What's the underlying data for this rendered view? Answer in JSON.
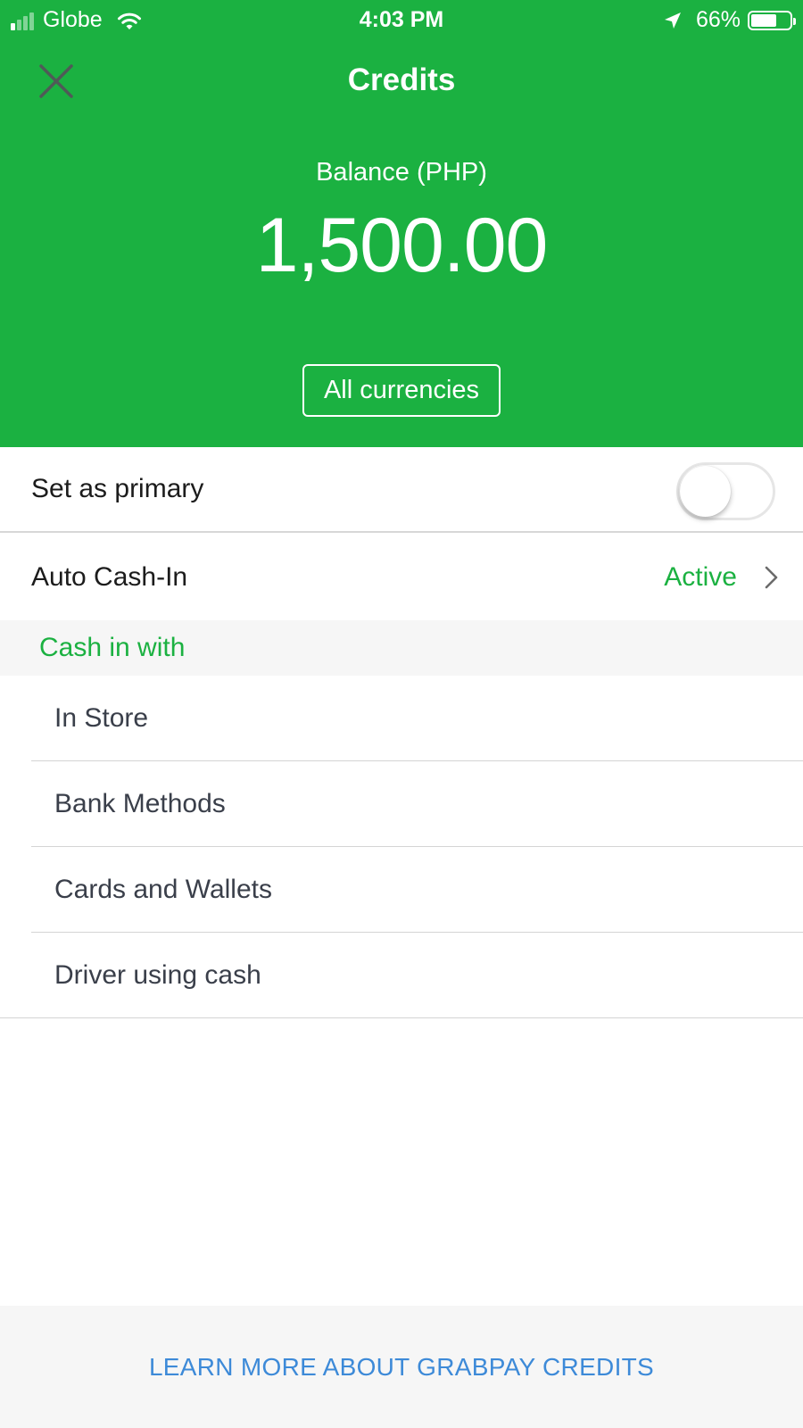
{
  "status_bar": {
    "carrier": "Globe",
    "time": "4:03 PM",
    "battery_percent": "66%",
    "battery_level": 0.66,
    "signal_bars_active": 1,
    "signal_bars_total": 4,
    "icons": [
      "signal-icon",
      "wifi-icon",
      "location-arrow-icon",
      "battery-icon"
    ]
  },
  "header": {
    "title": "Credits",
    "close_icon": "close-icon",
    "balance_label": "Balance (PHP)",
    "balance_amount": "1,500.00",
    "currency_button": "All currencies",
    "background_color": "#1BB141"
  },
  "settings": {
    "primary_label": "Set as primary",
    "primary_enabled": false,
    "auto_cash_in_label": "Auto Cash-In",
    "auto_cash_in_status": "Active",
    "status_color": "#1BB141"
  },
  "cash_in": {
    "section_title": "Cash in with",
    "items": [
      {
        "label": "In Store"
      },
      {
        "label": "Bank Methods"
      },
      {
        "label": "Cards and Wallets"
      },
      {
        "label": "Driver using cash"
      }
    ]
  },
  "footer": {
    "link_text": "LEARN MORE ABOUT GRABPAY CREDITS",
    "link_color": "#3d8ad8"
  }
}
